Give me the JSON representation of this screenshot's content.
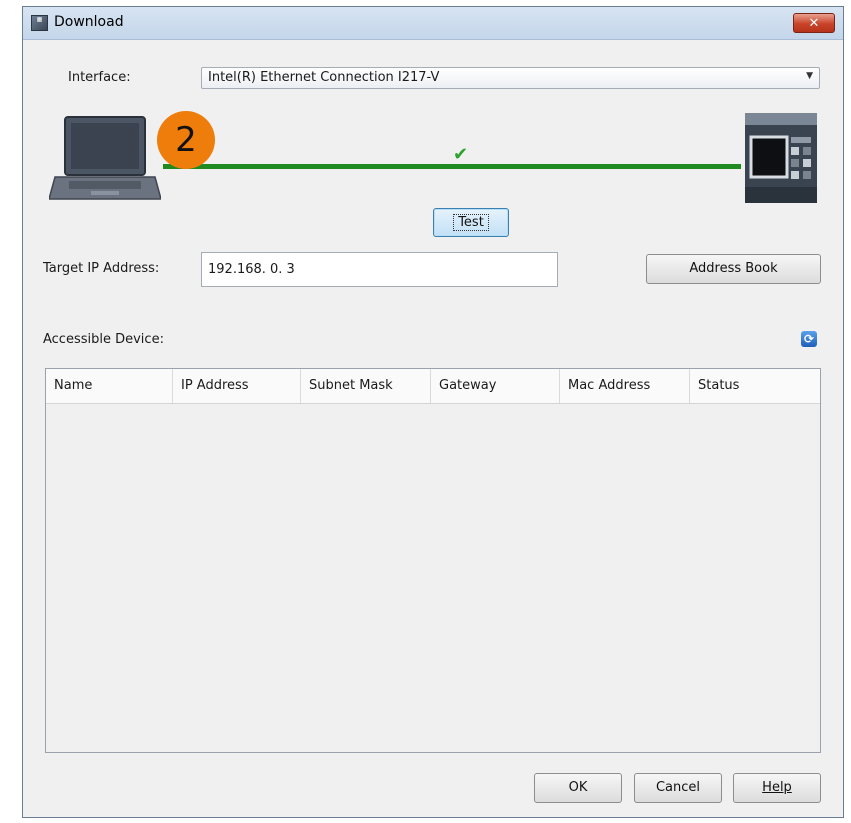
{
  "window": {
    "title": "Download",
    "close_symbol": "✕"
  },
  "interface": {
    "label": "Interface:",
    "selected": "Intel(R) Ethernet Connection I217-V"
  },
  "connection": {
    "status_icon": "checkmark-icon",
    "step_badge": "2",
    "line_color": "#1e8a20",
    "badge_color": "#ee7d0c"
  },
  "buttons": {
    "test": "Test",
    "address_book": "Address Book",
    "ok": "OK",
    "cancel": "Cancel",
    "help": "Help"
  },
  "target_ip": {
    "label": "Target IP Address:",
    "value": "192.168.  0.  3"
  },
  "devices": {
    "label": "Accessible Device:",
    "columns": [
      "Name",
      "IP Address",
      "Subnet Mask",
      "Gateway",
      "Mac Address",
      "Status"
    ],
    "rows": []
  }
}
